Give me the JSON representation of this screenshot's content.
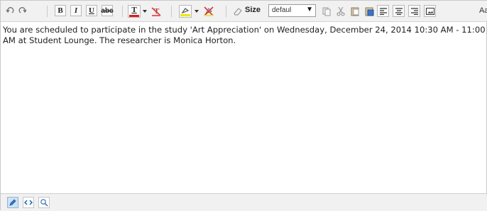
{
  "toolbar": {
    "undo_icon": "undo-icon",
    "redo_icon": "redo-icon",
    "bold_label": "B",
    "italic_label": "I",
    "underline_label": "U",
    "strike_label": "abc",
    "font_color_label": "T",
    "font_color": "#e21b1b",
    "highlight_color": "#f3e600",
    "size_label": "Size",
    "size_value": "defaul",
    "size_arrow": "▼",
    "font_label": "Aa"
  },
  "content": {
    "text": "You are scheduled to participate in the study 'Art Appreciation' on Wednesday, December 24, 2014 10:30 AM - 11:00 AM at Student Lounge. The researcher is Monica Horton."
  },
  "status_modes": [
    "design",
    "html",
    "preview"
  ]
}
